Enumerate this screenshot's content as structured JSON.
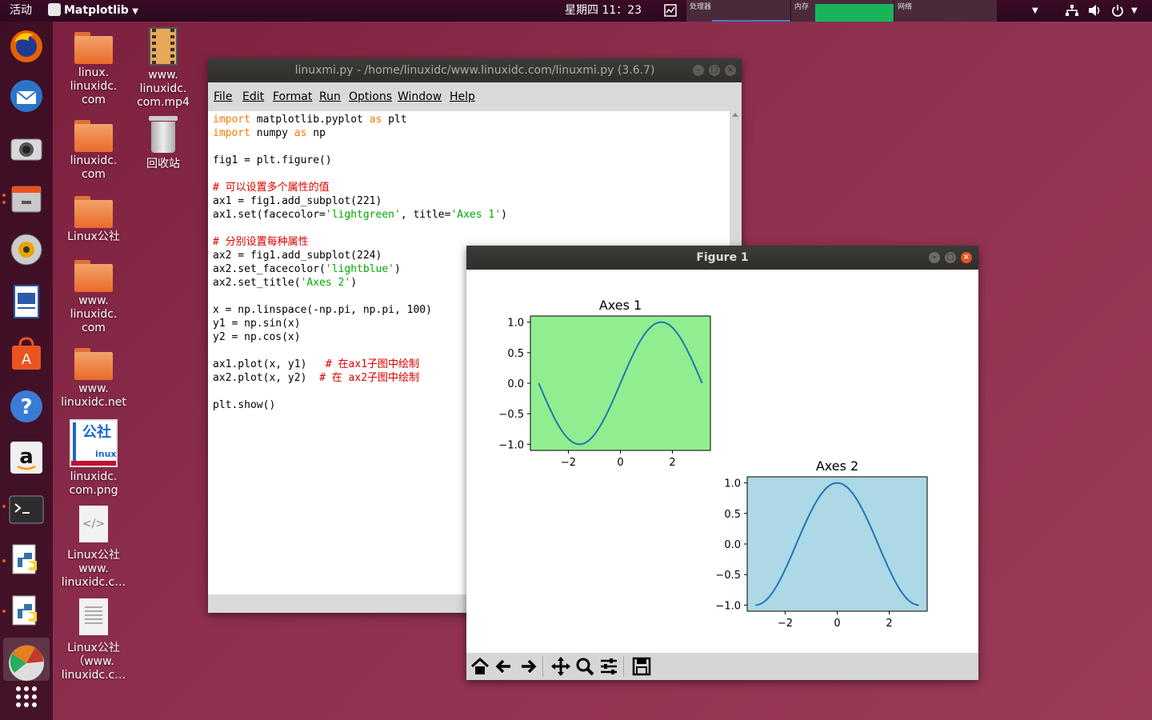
{
  "topbar": {
    "activities": "活动",
    "app_menu": "Matplotlib",
    "clock": "星期四 11：23",
    "monitor_labels": [
      "处理器",
      "内存",
      "网络"
    ],
    "colors": {
      "memory": "#19b45a"
    }
  },
  "dock": {
    "icons": [
      "firefox-icon",
      "thunderbird-icon",
      "camera-icon",
      "file-cabinet-icon",
      "speaker-icon",
      "writer-icon",
      "software-store-icon",
      "help-icon",
      "amazon-icon",
      "terminal-icon",
      "python-icon",
      "python-icon-2",
      "matplotlib-icon",
      "apps-grid-icon"
    ]
  },
  "desktop": {
    "col1": [
      {
        "label": "linux.\nlinuxidc.\ncom",
        "icon": "folder-icon"
      },
      {
        "label": "linuxidc.\ncom",
        "icon": "folder-icon"
      },
      {
        "label": "Linux公社",
        "icon": "folder-icon"
      },
      {
        "label": "www.\nlinuxidc.\ncom",
        "icon": "folder-icon"
      },
      {
        "label": "www.\nlinuxidc.net",
        "icon": "folder-icon"
      },
      {
        "label": "linuxidc.\ncom.png",
        "icon": "image-icon",
        "logo_text": [
          "公社",
          "inux"
        ]
      },
      {
        "label": "Linux公社\nwww.\nlinuxidc.c…",
        "icon": "code-file-icon"
      },
      {
        "label": "Linux公社\n（www.\nlinuxidc.c…",
        "icon": "text-file-icon"
      }
    ],
    "col2": [
      {
        "label": "www.\nlinuxidc.\ncom.mp4",
        "icon": "video-icon"
      },
      {
        "label": "回收站",
        "icon": "trash-icon"
      }
    ]
  },
  "idle": {
    "title": "linuxmi.py - /home/linuxidc/www.linuxidc.com/linuxmi.py (3.6.7)",
    "menu": [
      "File",
      "Edit",
      "Format",
      "Run",
      "Options",
      "Window",
      "Help"
    ],
    "code_lines": [
      [
        {
          "t": "import",
          "c": "kw"
        },
        {
          "t": " matplotlib.pyplot "
        },
        {
          "t": "as",
          "c": "kw"
        },
        {
          "t": " plt"
        }
      ],
      [
        {
          "t": "import",
          "c": "kw"
        },
        {
          "t": " numpy "
        },
        {
          "t": "as",
          "c": "kw"
        },
        {
          "t": " np"
        }
      ],
      [],
      [
        {
          "t": "fig1 = plt.figure()"
        }
      ],
      [],
      [
        {
          "t": "# 可以设置多个属性的值",
          "c": "cm"
        }
      ],
      [
        {
          "t": "ax1 = fig1.add_subplot(221)"
        }
      ],
      [
        {
          "t": "ax1.set(facecolor="
        },
        {
          "t": "'lightgreen'",
          "c": "st"
        },
        {
          "t": ", title="
        },
        {
          "t": "'Axes 1'",
          "c": "st"
        },
        {
          "t": ")"
        }
      ],
      [],
      [
        {
          "t": "# 分别设置每种属性",
          "c": "cm"
        }
      ],
      [
        {
          "t": "ax2 = fig1.add_subplot(224)"
        }
      ],
      [
        {
          "t": "ax2.set_facecolor("
        },
        {
          "t": "'lightblue'",
          "c": "st"
        },
        {
          "t": ")"
        }
      ],
      [
        {
          "t": "ax2.set_title("
        },
        {
          "t": "'Axes 2'",
          "c": "st"
        },
        {
          "t": ")"
        }
      ],
      [],
      [
        {
          "t": "x = np.linspace(-np.pi, np.pi, 100)"
        }
      ],
      [
        {
          "t": "y1 = np.sin(x)"
        }
      ],
      [
        {
          "t": "y2 = np.cos(x)"
        }
      ],
      [],
      [
        {
          "t": "ax1.plot(x, y1)   "
        },
        {
          "t": "# 在ax1子图中绘制",
          "c": "cm"
        }
      ],
      [
        {
          "t": "ax2.plot(x, y2)  "
        },
        {
          "t": "# 在 ax2子图中绘制",
          "c": "cm"
        }
      ],
      [],
      [
        {
          "t": "plt.show()"
        }
      ]
    ]
  },
  "figure": {
    "title": "Figure 1",
    "toolbar": [
      "home-icon",
      "back-icon",
      "forward-icon",
      "pan-icon",
      "zoom-icon",
      "configure-icon",
      "save-icon"
    ]
  },
  "chart_data": [
    {
      "type": "line",
      "title": "Axes 1",
      "facecolor": "#90ee90",
      "line_color": "#1f77b4",
      "xlim": [
        -3.46,
        3.46
      ],
      "ylim": [
        -1.1,
        1.1
      ],
      "xticks": [
        -2,
        0,
        2
      ],
      "xtick_labels": [
        "−2",
        "0",
        "2"
      ],
      "yticks": [
        1.0,
        0.5,
        0.0,
        -0.5,
        -1.0
      ],
      "ytick_labels": [
        "1.0",
        "0.5",
        "0.0",
        "−0.5",
        "−1.0"
      ],
      "series": [
        {
          "function": "sin",
          "x_range": [
            -3.14159,
            3.14159
          ],
          "points": 100
        }
      ]
    },
    {
      "type": "line",
      "title": "Axes 2",
      "facecolor": "#add8e6",
      "line_color": "#1f77b4",
      "xlim": [
        -3.46,
        3.46
      ],
      "ylim": [
        -1.1,
        1.1
      ],
      "xticks": [
        -2,
        0,
        2
      ],
      "xtick_labels": [
        "−2",
        "0",
        "2"
      ],
      "yticks": [
        1.0,
        0.5,
        0.0,
        -0.5,
        -1.0
      ],
      "ytick_labels": [
        "1.0",
        "0.5",
        "0.0",
        "−0.5",
        "−1.0"
      ],
      "series": [
        {
          "function": "cos",
          "x_range": [
            -3.14159,
            3.14159
          ],
          "points": 100
        }
      ]
    }
  ]
}
